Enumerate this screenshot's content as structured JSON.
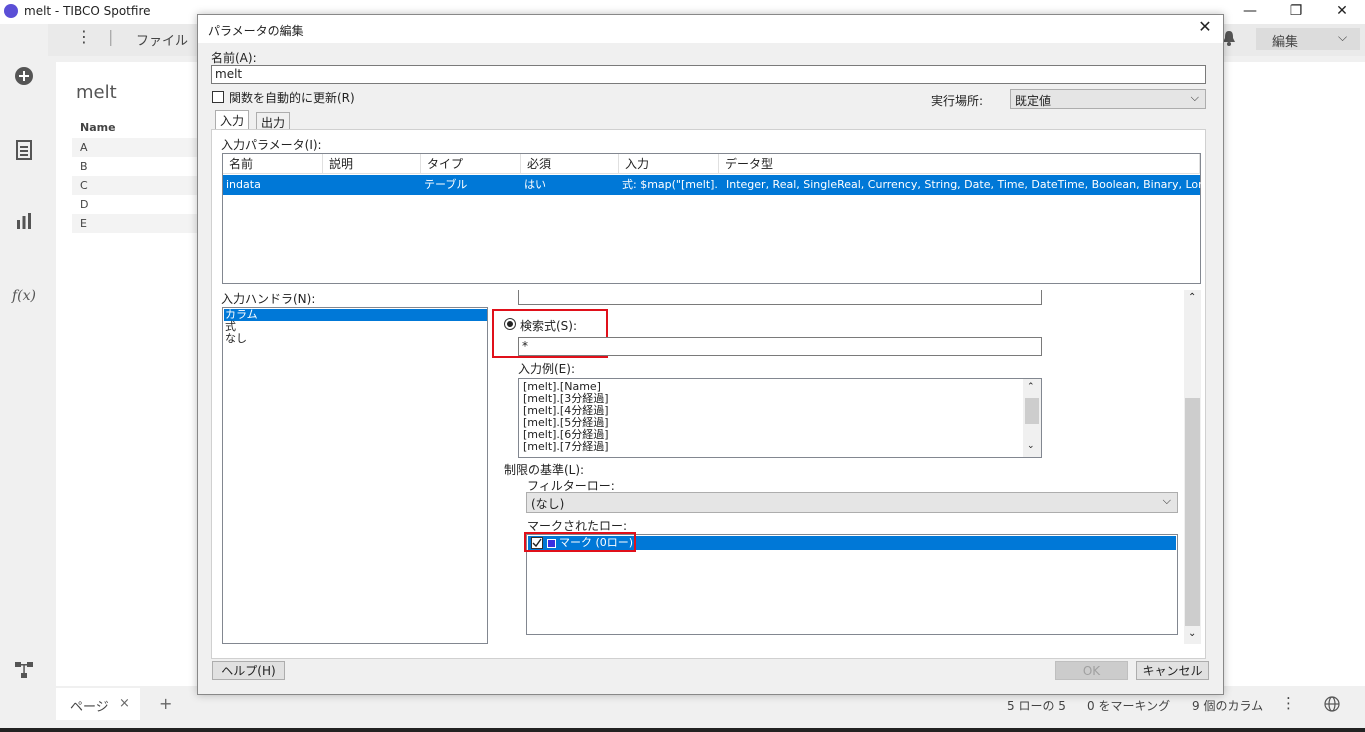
{
  "app": {
    "title": "melt - TIBCO Spotfire",
    "menu_label": "ファイル",
    "edit_label": "編集",
    "minimize": "—",
    "restore": "❐",
    "close": "✕"
  },
  "table": {
    "title": "melt",
    "column_header": "Name",
    "rows": [
      "A",
      "B",
      "C",
      "D",
      "E"
    ]
  },
  "status": {
    "page_tab": "ページ",
    "page_close": "×",
    "add_page": "+",
    "rows": "5 ローの 5",
    "marking": "0 をマーキング",
    "columns": "9 個のカラム"
  },
  "dialog": {
    "title": "パラメータの編集",
    "close": "✕",
    "name_label": "名前(A):",
    "name_value": "melt",
    "auto_update_label": "関数を自動的に更新(R)",
    "exec_location_label": "実行場所:",
    "exec_location_value": "既定値",
    "tabs": [
      "入力",
      "出力"
    ],
    "input_params_label": "入力パラメータ(I):",
    "grid_headers": [
      "名前",
      "説明",
      "タイプ",
      "必須",
      "入力",
      "データ型"
    ],
    "grid_row": [
      "indata",
      "",
      "テーブル",
      "はい",
      "式: $map(\"[melt]....",
      "Integer, Real, SingleReal, Currency, String, Date, Time, DateTime, Boolean, Binary, LongInteger"
    ],
    "input_handler_label": "入力ハンドラ(N):",
    "input_handlers": [
      "カラム",
      "式",
      "なし"
    ],
    "search_expr_label": "検索式(S):",
    "search_expr_value": "*",
    "example_label": "入力例(E):",
    "examples": [
      "[melt].[Name]",
      "[melt].[3分経過]",
      "[melt].[4分経過]",
      "[melt].[5分経過]",
      "[melt].[6分経過]",
      "[melt].[7分経過]"
    ],
    "limit_label": "制限の基準(L):",
    "filter_label": "フィルターロー:",
    "filter_value": "(なし)",
    "marked_label": "マークされたロー:",
    "marking_item": "マーク (0ロー)",
    "help_button": "ヘルプ(H)",
    "ok_button": "OK",
    "cancel_button": "キャンセル",
    "accent_color": "#0078d7",
    "highlight_color": "#e0101a"
  }
}
